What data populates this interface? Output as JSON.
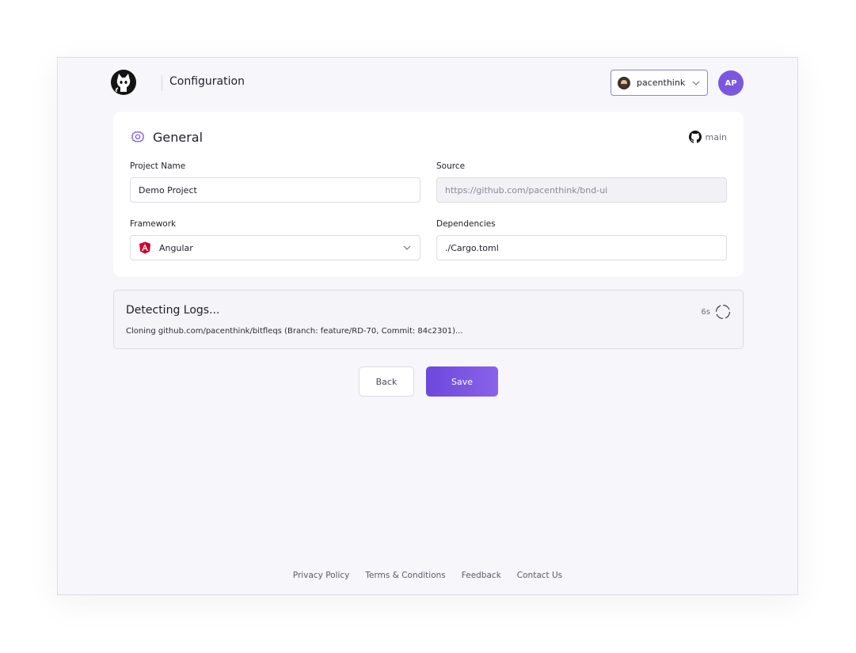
{
  "header": {
    "title": "Configuration",
    "project_select": {
      "value": "pacenthink"
    },
    "avatar_initials": "AP"
  },
  "general": {
    "title": "General",
    "branch": "main",
    "fields": {
      "project_name": {
        "label": "Project Name",
        "value": "Demo Project"
      },
      "source": {
        "label": "Source",
        "value": "https://github.com/pacenthink/bnd-ui"
      },
      "framework": {
        "label": "Framework",
        "value": "Angular",
        "icon": "angular-icon"
      },
      "dependencies": {
        "label": "Dependencies",
        "value": "./Cargo.toml"
      }
    }
  },
  "logs": {
    "title": "Detecting Logs...",
    "line": "Cloning github.com/pacenthink/bitfleqs (Branch: feature/RD-70, Commit: 84c2301)...",
    "elapsed": "6s"
  },
  "actions": {
    "back_label": "Back",
    "save_label": "Save"
  },
  "footer": {
    "links": [
      "Privacy Policy",
      "Terms & Conditions",
      "Feedback",
      "Contact Us"
    ]
  },
  "colors": {
    "accent": "#7b57e0",
    "save_gradient_start": "#6c48dd",
    "save_gradient_end": "#8a62ea",
    "angular_red": "#dd0031",
    "panel_bg": "#f6f6fb"
  }
}
